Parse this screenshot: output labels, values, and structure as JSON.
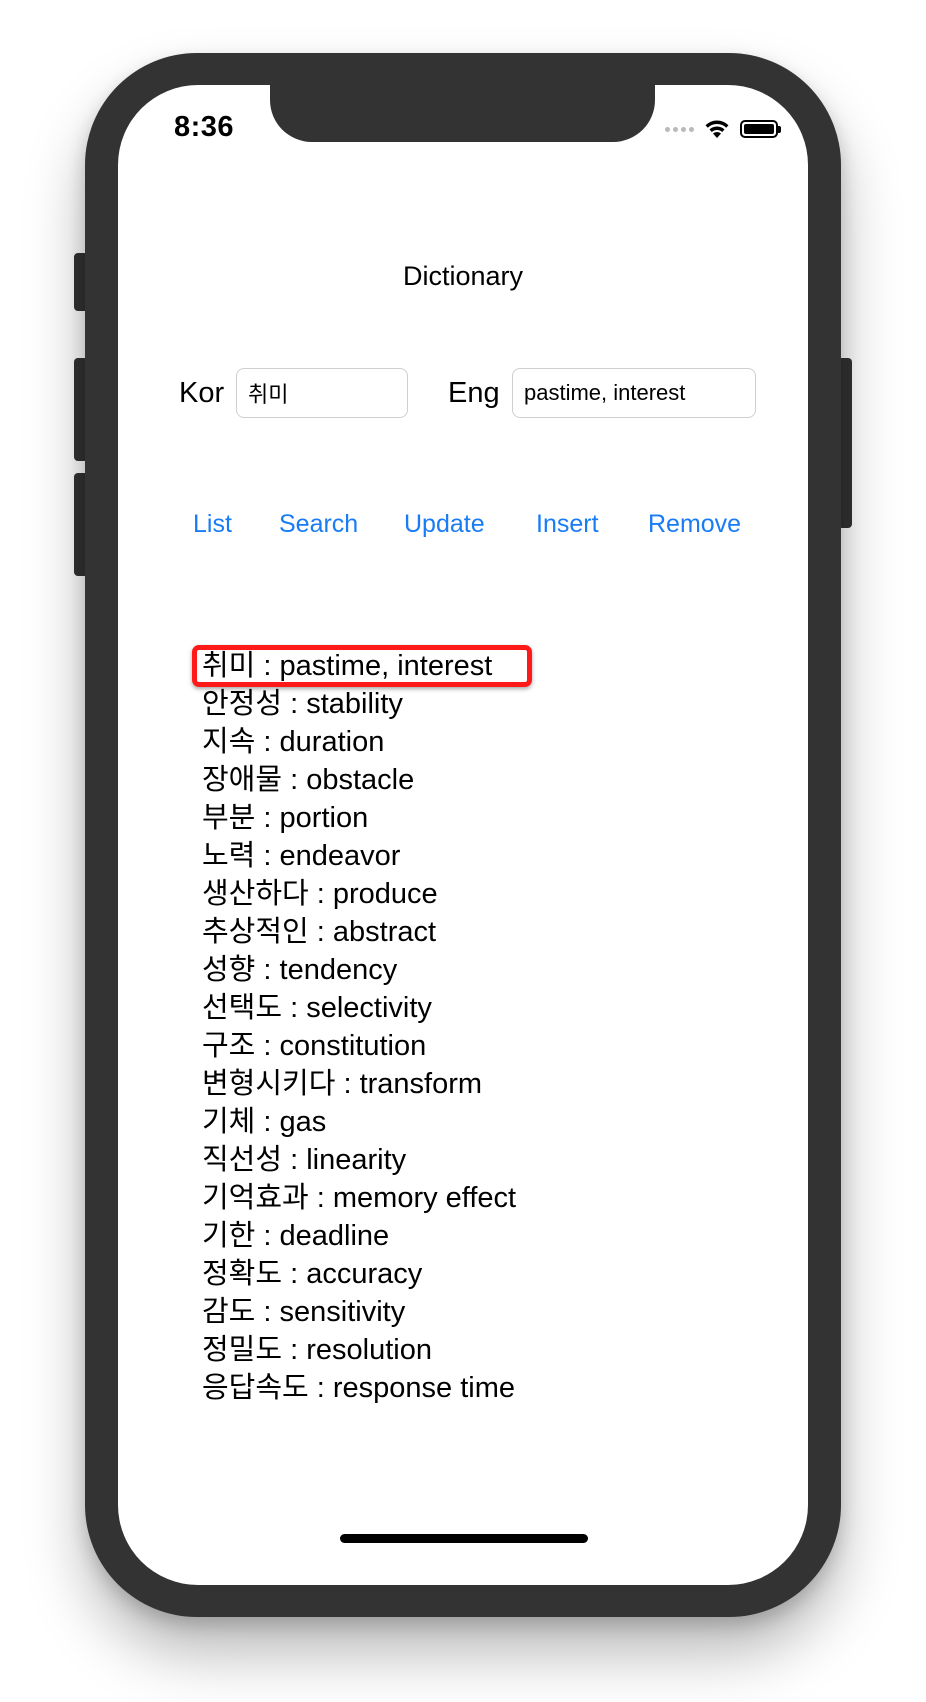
{
  "status_bar": {
    "time": "8:36",
    "icons": [
      "cellular-signal-icon",
      "wifi-icon",
      "battery-icon"
    ]
  },
  "header": {
    "title": "Dictionary"
  },
  "form": {
    "kor_label": "Kor",
    "kor_value": "취미",
    "eng_label": "Eng",
    "eng_value": "pastime, interest"
  },
  "actions": {
    "list": "List",
    "search": "Search",
    "update": "Update",
    "insert": "Insert",
    "remove": "Remove"
  },
  "results": [
    "취미 : pastime, interest",
    "안정성 : stability",
    "지속 : duration",
    "장애물 : obstacle",
    "부분 : portion",
    "노력 : endeavor",
    "생산하다 : produce",
    "추상적인 : abstract",
    "성향 : tendency",
    "선택도 : selectivity",
    "구조 : constitution",
    "변형시키다 : transform",
    "기체 : gas",
    "직선성 : linearity",
    "기억효과 : memory effect",
    "기한 : deadline",
    "정확도 : accuracy",
    "감도 : sensitivity",
    "정밀도 : resolution",
    "응답속도 : response time"
  ],
  "highlighted_index": 0,
  "colors": {
    "accent": "#1a7cf5",
    "highlight": "#ff1a1a",
    "phone_frame": "#333333"
  }
}
